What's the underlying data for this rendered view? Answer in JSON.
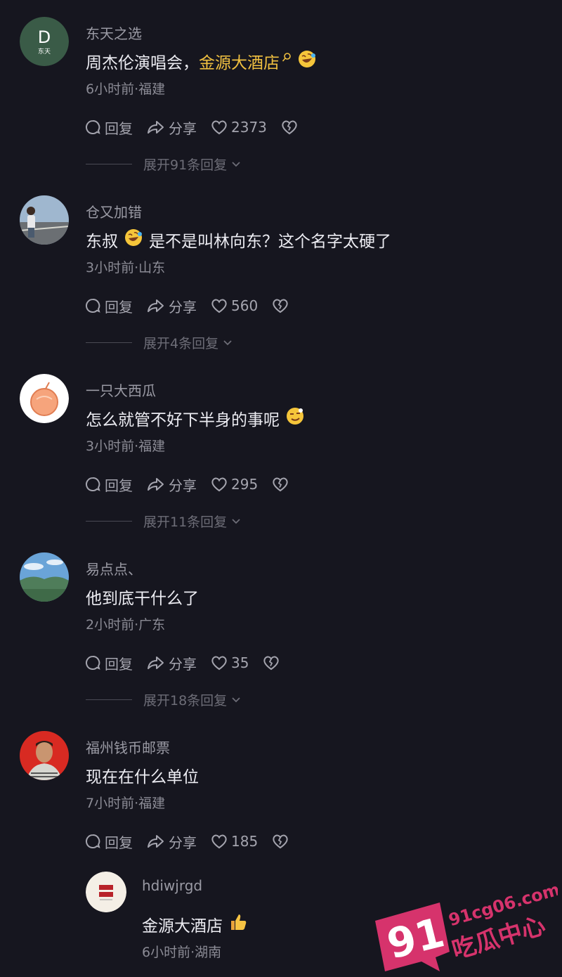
{
  "comments": [
    {
      "username": "东天之选",
      "text_before": "周杰伦演唱会，",
      "link": "金源大酒店",
      "text_after": "",
      "emoji": "rofl-emoji",
      "time": "6小时前",
      "location": "福建",
      "reply_label": "回复",
      "share_label": "分享",
      "likes": "2373",
      "expand_label": "展开91条回复",
      "avatar": {
        "letter": "D",
        "sub": "东天",
        "bg": "#3a5b47"
      }
    },
    {
      "username": "仓又加错",
      "text_before": "东叔",
      "emoji_inline": "rofl-emoji",
      "text_after": "是不是叫林向东？这个名字太硬了",
      "time": "3小时前",
      "location": "山东",
      "reply_label": "回复",
      "share_label": "分享",
      "likes": "560",
      "expand_label": "展开4条回复"
    },
    {
      "username": "一只大西瓜",
      "text_before": "怎么就管不好下半身的事呢",
      "emoji": "smirk-emoji",
      "time": "3小时前",
      "location": "福建",
      "reply_label": "回复",
      "share_label": "分享",
      "likes": "295",
      "expand_label": "展开11条回复"
    },
    {
      "username": "易点点、",
      "text_before": "他到底干什么了",
      "time": "2小时前",
      "location": "广东",
      "reply_label": "回复",
      "share_label": "分享",
      "likes": "35",
      "expand_label": "展开18条回复"
    },
    {
      "username": "福州钱币邮票",
      "text_before": "现在在什么单位",
      "time": "7小时前",
      "location": "福建",
      "reply_label": "回复",
      "share_label": "分享",
      "likes": "185"
    }
  ],
  "reply": {
    "username": "hdiwjrgd",
    "text": "金源大酒店",
    "emoji": "thumbs-up-emoji",
    "time": "6小时前",
    "location": "湖南"
  },
  "separator": "·",
  "watermark": {
    "domain": "91cg06.com",
    "brand": "吃瓜中心",
    "number": "91"
  },
  "colors": {
    "background": "#16161f",
    "link": "#f0c040",
    "watermark": "#d6336c"
  }
}
